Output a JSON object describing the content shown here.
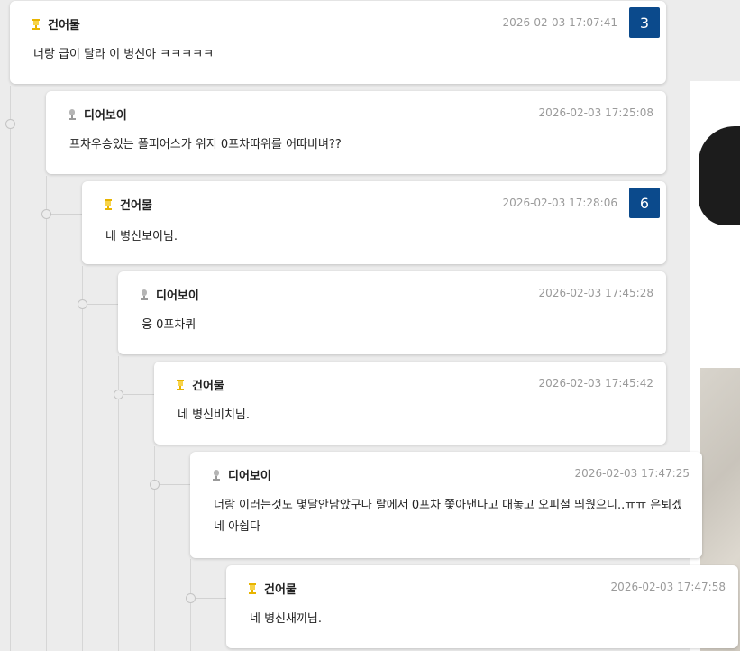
{
  "comments": [
    {
      "author": "건어물",
      "author_icon": "gold-trophy-icon",
      "time": "2026-02-03 17:07:41",
      "text": "너랑 급이 달라 이 병신아 ㅋㅋㅋㅋㅋ",
      "badge": "3"
    },
    {
      "author": "디어보이",
      "author_icon": "gray-trophy-icon",
      "time": "2026-02-03 17:25:08",
      "text": "프차우승있는 폴피어스가 위지 0프차따위를 어따비벼??"
    },
    {
      "author": "건어물",
      "author_icon": "gold-trophy-icon",
      "time": "2026-02-03 17:28:06",
      "text": "네 병신보이님.",
      "badge": "6"
    },
    {
      "author": "디어보이",
      "author_icon": "gray-trophy-icon",
      "time": "2026-02-03 17:45:28",
      "text": "응 0프차퀴"
    },
    {
      "author": "건어물",
      "author_icon": "gold-trophy-icon",
      "time": "2026-02-03 17:45:42",
      "text": "네 병신비치님."
    },
    {
      "author": "디어보이",
      "author_icon": "gray-trophy-icon",
      "time": "2026-02-03 17:47:25",
      "text_line1": "너랑 이러는것도 몇달안남았구나 랄에서 0프차 쫓아낸다고 대놓고 오피셜 띄웠으니..ㅠㅠ 은퇴겠",
      "text_line2": "네 아쉽다"
    },
    {
      "author": "건어물",
      "author_icon": "gold-trophy-icon",
      "time": "2026-02-03 17:47:58",
      "text": "네 병신새끼님."
    }
  ],
  "colors": {
    "badge_bg": "#0b4a8c",
    "gold_icon": "#e8b400",
    "gray_icon": "#9a9a9a"
  }
}
